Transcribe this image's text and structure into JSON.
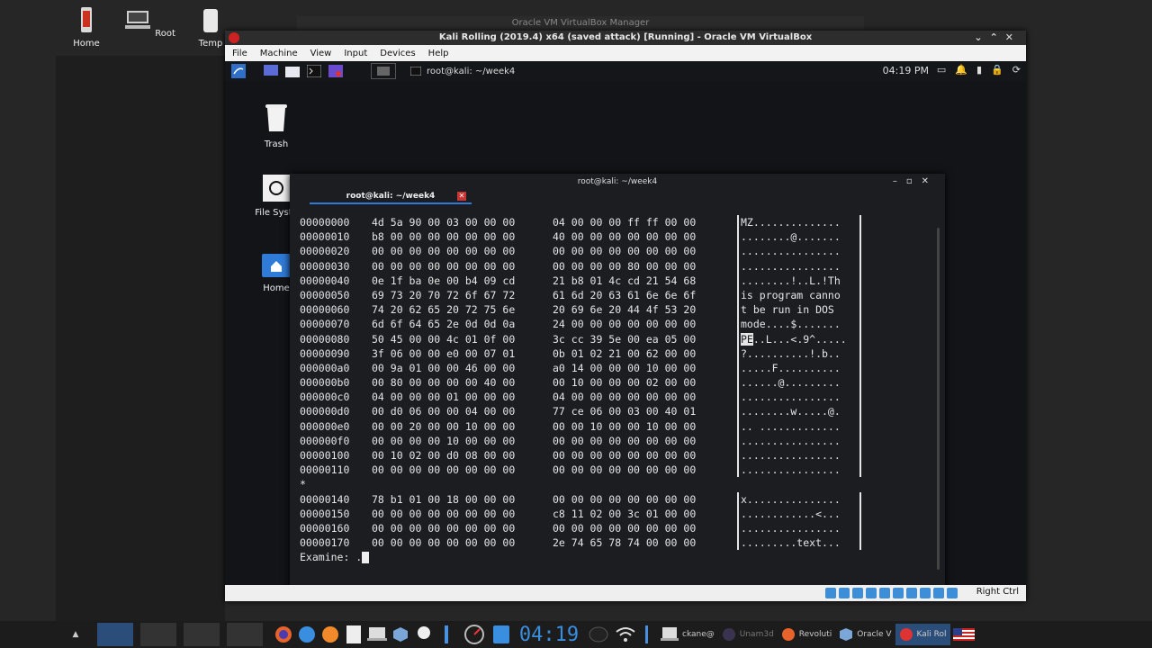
{
  "host": {
    "desktop_icons": [
      {
        "label": "Home",
        "icon": "home-drive-icon"
      },
      {
        "label": "Root",
        "icon": "computer-icon"
      },
      {
        "label": "Temp",
        "icon": "folder-icon"
      }
    ],
    "behind_window_title": "Oracle VM VirtualBox Manager",
    "taskbar": {
      "clock": "04:19",
      "tasks": [
        {
          "label": "ckane@",
          "icon": "terminal-icon"
        },
        {
          "label": "Unam3d",
          "icon": "app-icon"
        },
        {
          "label": "Revoluti",
          "icon": "firefox-icon"
        },
        {
          "label": "Oracle V",
          "icon": "virtualbox-icon"
        },
        {
          "label": "Kali Rol",
          "icon": "kali-icon"
        }
      ]
    }
  },
  "vm": {
    "title": "Kali Rolling (2019.4) x64 (saved attack) [Running] - Oracle VM VirtualBox",
    "menu": [
      "File",
      "Machine",
      "View",
      "Input",
      "Devices",
      "Help"
    ],
    "status_hostkey": "Right Ctrl"
  },
  "guest": {
    "panel_task": "root@kali: ~/week4",
    "clock": "04:19 PM",
    "desktop_icons": [
      {
        "label": "Trash",
        "icon": "trash-icon"
      },
      {
        "label": "File Syste",
        "icon": "file-system-icon"
      },
      {
        "label": "Home",
        "icon": "home-folder-icon"
      }
    ],
    "terminal": {
      "window_title": "root@kali: ~/week4",
      "tab_title": "root@kali: ~/week4",
      "rows": [
        {
          "off": "00000000",
          "b1": "4d 5a 90 00 03 00 00 00",
          "b2": "04 00 00 00 ff ff 00 00",
          "asc": "MZ.............."
        },
        {
          "off": "00000010",
          "b1": "b8 00 00 00 00 00 00 00",
          "b2": "40 00 00 00 00 00 00 00",
          "asc": "........@......."
        },
        {
          "off": "00000020",
          "b1": "00 00 00 00 00 00 00 00",
          "b2": "00 00 00 00 00 00 00 00",
          "asc": "................"
        },
        {
          "off": "00000030",
          "b1": "00 00 00 00 00 00 00 00",
          "b2": "00 00 00 00 80 00 00 00",
          "asc": "................"
        },
        {
          "off": "00000040",
          "b1": "0e 1f ba 0e 00 b4 09 cd",
          "b2": "21 b8 01 4c cd 21 54 68",
          "asc": "........!..L.!Th"
        },
        {
          "off": "00000050",
          "b1": "69 73 20 70 72 6f 67 72",
          "b2": "61 6d 20 63 61 6e 6e 6f",
          "asc": "is program canno"
        },
        {
          "off": "00000060",
          "b1": "74 20 62 65 20 72 75 6e",
          "b2": "20 69 6e 20 44 4f 53 20",
          "asc": "t be run in DOS "
        },
        {
          "off": "00000070",
          "b1": "6d 6f 64 65 2e 0d 0d 0a",
          "b2": "24 00 00 00 00 00 00 00",
          "asc": "mode....$......."
        },
        {
          "off": "00000080",
          "b1": "50 45 00 00 4c 01 0f 00",
          "b2": "3c cc 39 5e 00 ea 05 00",
          "asc_hl": "PE",
          "asc": "..L...<.9^....."
        },
        {
          "off": "00000090",
          "b1": "3f 06 00 00 e0 00 07 01",
          "b2": "0b 01 02 21 00 62 00 00",
          "asc": "?..........!.b.."
        },
        {
          "off": "000000a0",
          "b1": "00 9a 01 00 00 46 00 00",
          "b2": "a0 14 00 00 00 10 00 00",
          "asc": ".....F.........."
        },
        {
          "off": "000000b0",
          "b1": "00 80 00 00 00 00 40 00",
          "b2": "00 10 00 00 00 02 00 00",
          "asc": "......@........."
        },
        {
          "off": "000000c0",
          "b1": "04 00 00 00 01 00 00 00",
          "b2": "04 00 00 00 00 00 00 00",
          "asc": "................"
        },
        {
          "off": "000000d0",
          "b1": "00 d0 06 00 00 04 00 00",
          "b2": "77 ce 06 00 03 00 40 01",
          "asc": "........w.....@."
        },
        {
          "off": "000000e0",
          "b1": "00 00 20 00 00 10 00 00",
          "b2": "00 00 10 00 00 10 00 00",
          "asc": ".. ............."
        },
        {
          "off": "000000f0",
          "b1": "00 00 00 00 10 00 00 00",
          "b2": "00 00 00 00 00 00 00 00",
          "asc": "................"
        },
        {
          "off": "00000100",
          "b1": "00 10 02 00 d0 08 00 00",
          "b2": "00 00 00 00 00 00 00 00",
          "asc": "................"
        },
        {
          "off": "00000110",
          "b1": "00 00 00 00 00 00 00 00",
          "b2": "00 00 00 00 00 00 00 00",
          "asc": "................"
        },
        {
          "off": "*",
          "b1": "",
          "b2": "",
          "asc": "",
          "nobar": true
        },
        {
          "off": "00000140",
          "b1": "78 b1 01 00 18 00 00 00",
          "b2": "00 00 00 00 00 00 00 00",
          "asc": "x..............."
        },
        {
          "off": "00000150",
          "b1": "00 00 00 00 00 00 00 00",
          "b2": "c8 11 02 00 3c 01 00 00",
          "asc": "............<..."
        },
        {
          "off": "00000160",
          "b1": "00 00 00 00 00 00 00 00",
          "b2": "00 00 00 00 00 00 00 00",
          "asc": "................"
        },
        {
          "off": "00000170",
          "b1": "00 00 00 00 00 00 00 00",
          "b2": "2e 74 65 78 74 00 00 00",
          "asc": ".........text..."
        }
      ],
      "prompt": "Examine: ."
    }
  },
  "colors": {
    "accent": "#2f7bd8",
    "terminal_bg": "#1b1d21"
  }
}
